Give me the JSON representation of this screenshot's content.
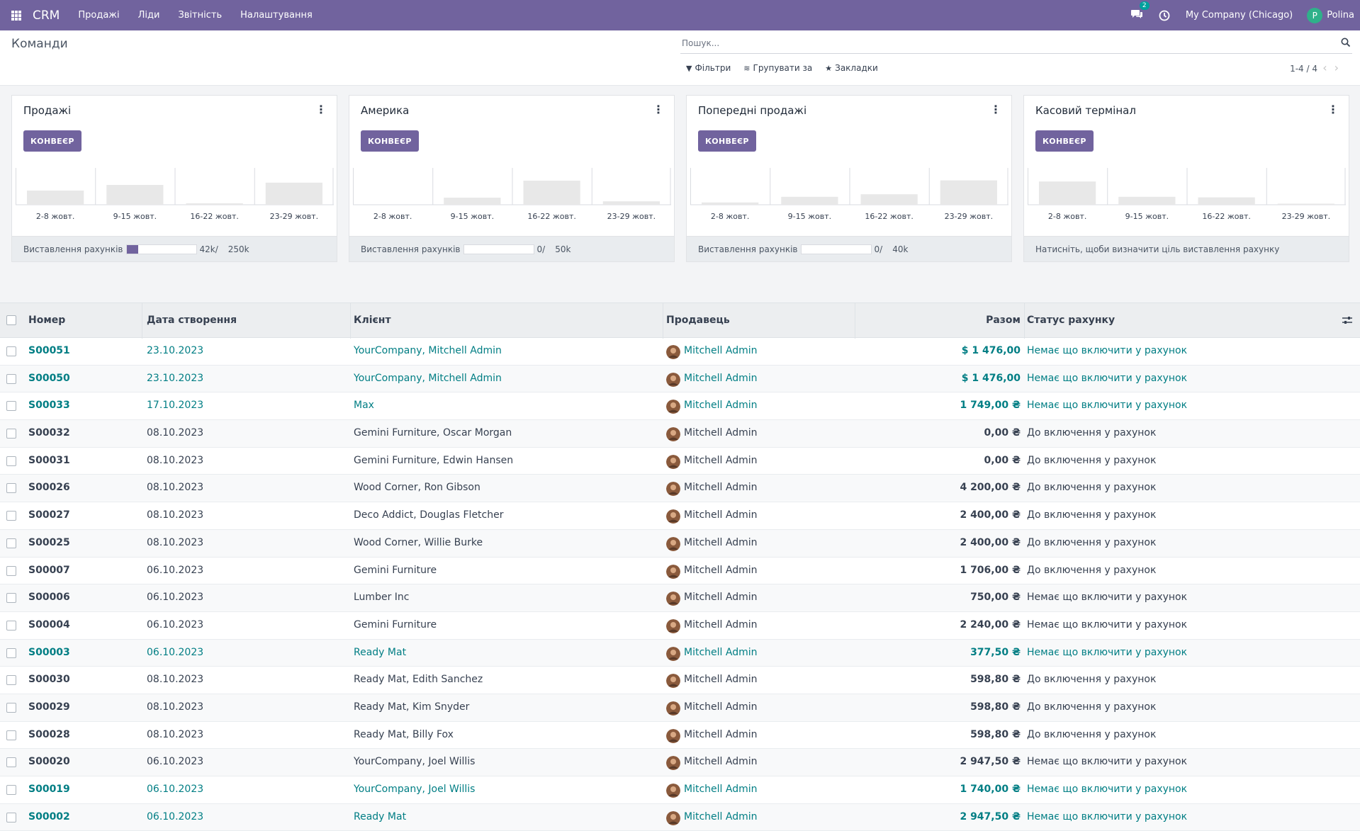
{
  "navbar": {
    "brand": "CRM",
    "menu": [
      "Продажі",
      "Ліди",
      "Звітність",
      "Налаштування"
    ],
    "chat_count": "2",
    "company": "My Company (Chicago)",
    "user_initial": "P",
    "user_name": "Polina",
    "icons": [
      "apps-grid-icon",
      "chat-icon",
      "clock-icon"
    ]
  },
  "control_panel": {
    "title": "Команди",
    "search_placeholder": "Пошук...",
    "filters": "Фільтри",
    "group_by": "Групувати за",
    "favorites": "Закладки",
    "pager": "1-4 / 4"
  },
  "teams": [
    {
      "name": "Продажі",
      "button": "КОНВЕЄР",
      "weeks": [
        "2-8 жовт.",
        "9-15 жовт.",
        "16-22 жовт.",
        "23-29 жовт."
      ],
      "bars": [
        0.5,
        0.7,
        0.05,
        0.78
      ],
      "footer_label": "Виставлення рахунків",
      "progress": 0.168,
      "current": "42k",
      "target": "250k"
    },
    {
      "name": "Америка",
      "button": "КОНВЕЄР",
      "weeks": [
        "2-8 жовт.",
        "9-15 жовт.",
        "16-22 жовт.",
        "23-29 жовт."
      ],
      "bars": [
        0.0,
        0.25,
        0.85,
        0.12
      ],
      "footer_label": "Виставлення рахунків",
      "progress": 0,
      "current": "0",
      "target": "50k"
    },
    {
      "name": "Попередні продажі",
      "button": "КОНВЕЄР",
      "weeks": [
        "2-8 жовт.",
        "9-15 жовт.",
        "16-22 жовт.",
        "23-29 жовт."
      ],
      "bars": [
        0.08,
        0.28,
        0.37,
        0.86
      ],
      "footer_label": "Виставлення рахунків",
      "progress": 0,
      "current": "0",
      "target": "40k"
    },
    {
      "name": "Касовий термінал",
      "button": "КОНВЕЄР",
      "weeks": [
        "2-8 жовт.",
        "9-15 жовт.",
        "16-22 жовт.",
        "23-29 жовт."
      ],
      "bars": [
        0.82,
        0.28,
        0.26,
        0.04
      ],
      "footer_note": "Натисніть, щоби визначити ціль виставлення рахунку"
    }
  ],
  "table": {
    "headers": [
      "Номер",
      "Дата створення",
      "Клієнт",
      "Продавець",
      "Разом",
      "Статус рахунку"
    ],
    "rows": [
      {
        "num": "S00051",
        "date": "23.10.2023",
        "client": "YourCompany, Mitchell Admin",
        "seller": "Mitchell Admin",
        "total": "$ 1 476,00",
        "status": "Немає що включити у рахунок",
        "link": true
      },
      {
        "num": "S00050",
        "date": "23.10.2023",
        "client": "YourCompany, Mitchell Admin",
        "seller": "Mitchell Admin",
        "total": "$ 1 476,00",
        "status": "Немає що включити у рахунок",
        "link": true
      },
      {
        "num": "S00033",
        "date": "17.10.2023",
        "client": "Max",
        "seller": "Mitchell Admin",
        "total": "1 749,00 ₴",
        "status": "Немає що включити у рахунок",
        "link": true
      },
      {
        "num": "S00032",
        "date": "08.10.2023",
        "client": "Gemini Furniture, Oscar Morgan",
        "seller": "Mitchell Admin",
        "total": "0,00 ₴",
        "status": "До включення у рахунок",
        "link": false
      },
      {
        "num": "S00031",
        "date": "08.10.2023",
        "client": "Gemini Furniture, Edwin Hansen",
        "seller": "Mitchell Admin",
        "total": "0,00 ₴",
        "status": "До включення у рахунок",
        "link": false
      },
      {
        "num": "S00026",
        "date": "08.10.2023",
        "client": "Wood Corner, Ron Gibson",
        "seller": "Mitchell Admin",
        "total": "4 200,00 ₴",
        "status": "До включення у рахунок",
        "link": false
      },
      {
        "num": "S00027",
        "date": "08.10.2023",
        "client": "Deco Addict, Douglas Fletcher",
        "seller": "Mitchell Admin",
        "total": "2 400,00 ₴",
        "status": "До включення у рахунок",
        "link": false
      },
      {
        "num": "S00025",
        "date": "08.10.2023",
        "client": "Wood Corner, Willie Burke",
        "seller": "Mitchell Admin",
        "total": "2 400,00 ₴",
        "status": "До включення у рахунок",
        "link": false
      },
      {
        "num": "S00007",
        "date": "06.10.2023",
        "client": "Gemini Furniture",
        "seller": "Mitchell Admin",
        "total": "1 706,00 ₴",
        "status": "До включення у рахунок",
        "link": false
      },
      {
        "num": "S00006",
        "date": "06.10.2023",
        "client": "Lumber Inc",
        "seller": "Mitchell Admin",
        "total": "750,00 ₴",
        "status": "Немає що включити у рахунок",
        "link": false
      },
      {
        "num": "S00004",
        "date": "06.10.2023",
        "client": "Gemini Furniture",
        "seller": "Mitchell Admin",
        "total": "2 240,00 ₴",
        "status": "Немає що включити у рахунок",
        "link": false
      },
      {
        "num": "S00003",
        "date": "06.10.2023",
        "client": "Ready Mat",
        "seller": "Mitchell Admin",
        "total": "377,50 ₴",
        "status": "Немає що включити у рахунок",
        "link": true
      },
      {
        "num": "S00030",
        "date": "08.10.2023",
        "client": "Ready Mat, Edith Sanchez",
        "seller": "Mitchell Admin",
        "total": "598,80 ₴",
        "status": "До включення у рахунок",
        "link": false
      },
      {
        "num": "S00029",
        "date": "08.10.2023",
        "client": "Ready Mat, Kim Snyder",
        "seller": "Mitchell Admin",
        "total": "598,80 ₴",
        "status": "До включення у рахунок",
        "link": false
      },
      {
        "num": "S00028",
        "date": "08.10.2023",
        "client": "Ready Mat, Billy Fox",
        "seller": "Mitchell Admin",
        "total": "598,80 ₴",
        "status": "До включення у рахунок",
        "link": false
      },
      {
        "num": "S00020",
        "date": "06.10.2023",
        "client": "YourCompany, Joel Willis",
        "seller": "Mitchell Admin",
        "total": "2 947,50 ₴",
        "status": "Немає що включити у рахунок",
        "link": false
      },
      {
        "num": "S00019",
        "date": "06.10.2023",
        "client": "YourCompany, Joel Willis",
        "seller": "Mitchell Admin",
        "total": "1 740,00 ₴",
        "status": "Немає що включити у рахунок",
        "link": true
      },
      {
        "num": "S00002",
        "date": "06.10.2023",
        "client": "Ready Mat",
        "seller": "Mitchell Admin",
        "total": "2 947,50 ₴",
        "status": "Немає що включити у рахунок",
        "link": true
      }
    ]
  },
  "colors": {
    "navbar": "#71639e",
    "link": "#017e84",
    "bar": "#e8e8e8"
  }
}
